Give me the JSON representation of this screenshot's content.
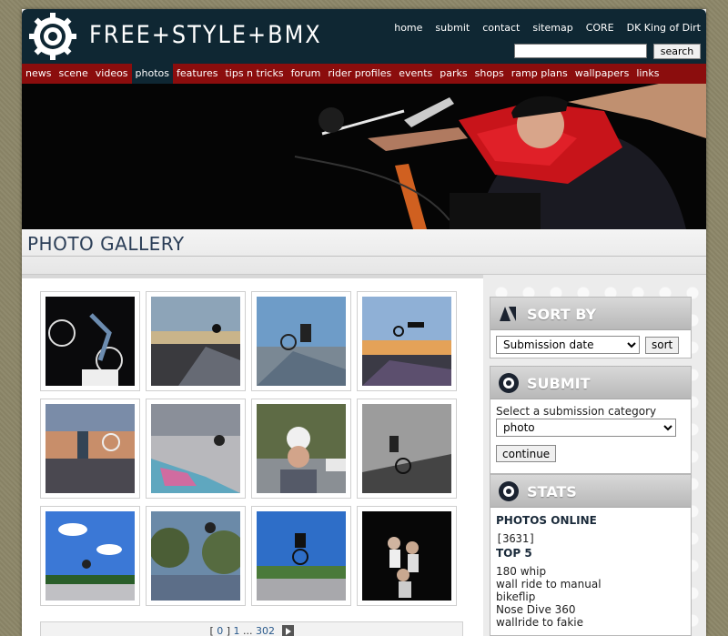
{
  "site": {
    "logo_text": "FREE+STYLE+BMX"
  },
  "topnav": [
    "home",
    "submit",
    "contact",
    "sitemap",
    "CORE",
    "DK King of Dirt"
  ],
  "search": {
    "button_label": "search",
    "value": ""
  },
  "mainnav": {
    "items": [
      "news",
      "scene",
      "videos",
      "photos",
      "features",
      "tips n tricks",
      "forum",
      "rider profiles",
      "events",
      "parks",
      "shops",
      "ramp plans",
      "wallpapers",
      "links"
    ],
    "active": "photos"
  },
  "page": {
    "title": "PHOTO GALLERY"
  },
  "gallery": {
    "thumbnails": [
      "bmx-night-trick",
      "bmx-sunset-ramp-1",
      "bmx-skatepark-blue",
      "bmx-sunset-air",
      "bmx-sunset-air-2",
      "bmx-graffiti-ramp",
      "rider-portrait-helmet",
      "bmx-bw-air",
      "bmx-blue-sky",
      "bmx-trees-air",
      "bmx-street-air",
      "riders-group-night"
    ],
    "pager": {
      "open": "[",
      "current": "0",
      "close": "]",
      "next_page": "1",
      "ellipsis": "...",
      "last_page": "302"
    }
  },
  "sort_panel": {
    "title": "SORT BY",
    "selected": "Submission date",
    "button": "sort"
  },
  "submit_panel": {
    "title": "SUBMIT",
    "prompt": "Select a submission category",
    "selected": "photo",
    "button": "continue"
  },
  "stats_panel": {
    "title": "STATS",
    "photos_online_label": "PHOTOS ONLINE",
    "photos_online_count": "[3631]",
    "top_label": "TOP 5",
    "top": [
      "180 whip",
      "wall ride to manual",
      "bikeflip",
      "Nose Dive 360",
      "wallride to fakie"
    ]
  },
  "colors": {
    "header_bg": "#0f2733",
    "nav_red": "#8b0d0d",
    "title_text": "#2b3e57"
  }
}
